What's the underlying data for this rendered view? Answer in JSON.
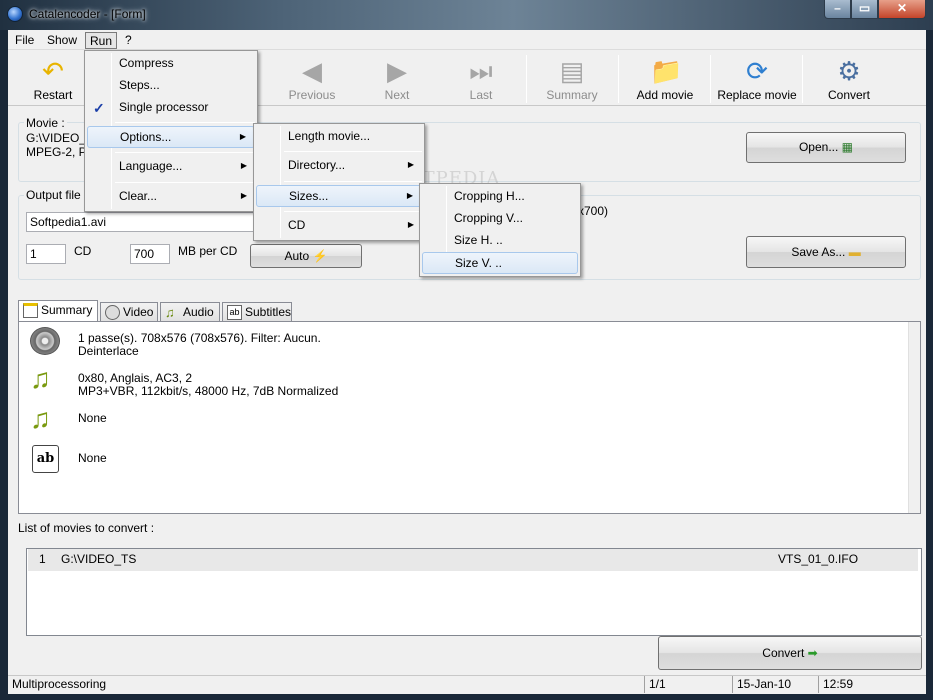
{
  "window": {
    "title": "Catalencoder - [Form]"
  },
  "menubar": {
    "items": [
      "File",
      "Show",
      "Run",
      "?"
    ]
  },
  "toolbar": {
    "restart": "Restart",
    "previous": "Previous",
    "next": "Next",
    "last": "Last",
    "summary": "Summary",
    "add_movie": "Add movie",
    "replace_movie": "Replace movie",
    "convert": "Convert"
  },
  "movie": {
    "label": "Movie :",
    "line1": "G:\\VIDEO_",
    "line2": "MPEG-2,  P.",
    "open_button": "Open..."
  },
  "output": {
    "label": "Output file :",
    "filename": "Softpedia1.avi",
    "cd_count": "1",
    "cd_label": "CD",
    "mb_per_cd": "700",
    "mb_per_cd_label": "MB per CD",
    "auto_button": "Auto",
    "size_text": "x700)",
    "save_as_button": "Save As..."
  },
  "tabs": [
    "Summary",
    "Video",
    "Audio",
    "Subtitles"
  ],
  "summary": {
    "video_line1": "1 passe(s). 708x576 (708x576). Filter: Aucun.",
    "video_line2": "Deinterlace",
    "audio1_line1": "0x80, Anglais,  AC3, 2",
    "audio1_line2": "MP3+VBR, 112kbit/s, 48000 Hz, 7dB Normalized",
    "audio2": "None",
    "subtitles": "None"
  },
  "movies_list": {
    "label": "List of movies to convert :",
    "rows": [
      {
        "num": "1",
        "path": "G:\\VIDEO_TS",
        "file": "VTS_01_0.IFO"
      }
    ]
  },
  "convert_button": "Convert",
  "status": {
    "text": "Multiprocessoring",
    "page": "1/1",
    "date": "15-Jan-10",
    "time": "12:59"
  },
  "run_menu": {
    "items": [
      "Compress",
      "Steps...",
      "Single processor",
      "Options...",
      "Language...",
      "Clear..."
    ]
  },
  "options_menu": {
    "items": [
      "Length movie...",
      "Directory...",
      "Sizes...",
      "CD"
    ]
  },
  "sizes_menu": {
    "items": [
      "Cropping H...",
      "Cropping V...",
      "Size H. ..",
      "Size V. .."
    ]
  },
  "watermark": "SOFTPEDIA"
}
